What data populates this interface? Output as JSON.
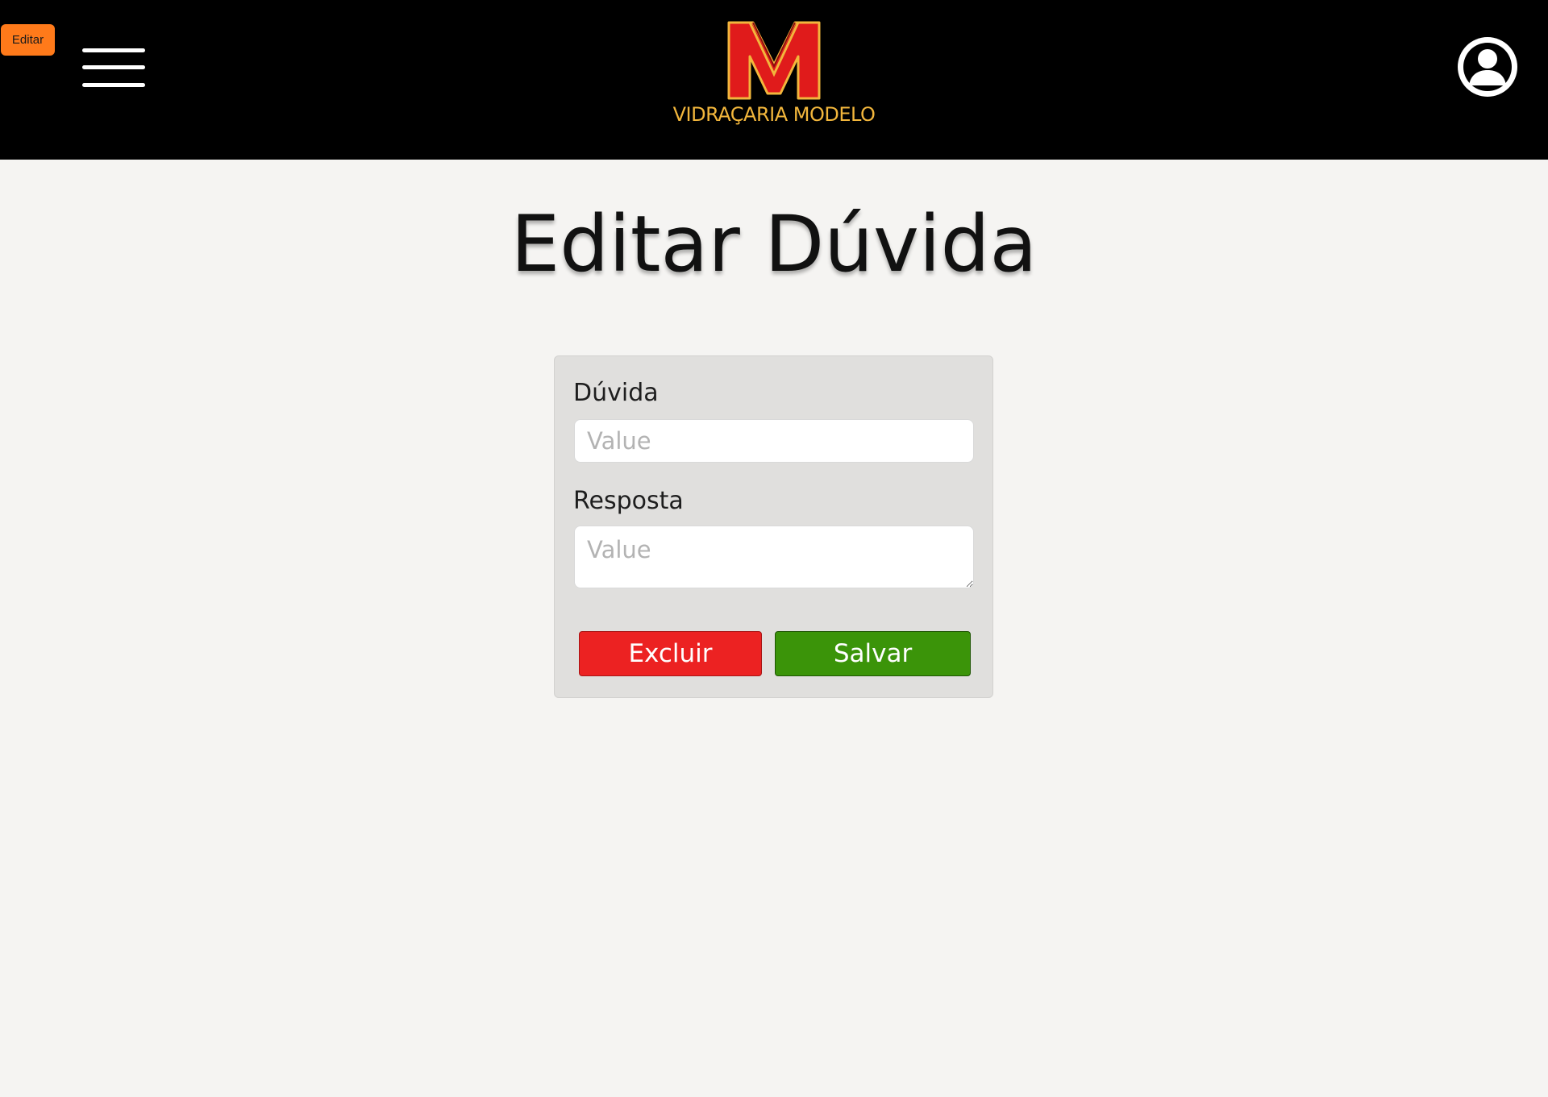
{
  "header": {
    "edit_badge": "Editar",
    "logo_text": "VIDRAÇARIA MODELO",
    "logo_icon": "logo-m-icon",
    "menu_icon": "hamburger-menu-icon",
    "profile_icon": "user-avatar-icon"
  },
  "page": {
    "title": "Editar Dúvida"
  },
  "form": {
    "question_label": "Dúvida",
    "question_placeholder": "Value",
    "answer_label": "Resposta",
    "answer_placeholder": "Value",
    "delete_label": "Excluir",
    "save_label": "Salvar"
  },
  "colors": {
    "header_bg": "#000000",
    "page_bg": "#f5f4f2",
    "card_bg": "#e0dfdd",
    "edit_badge": "#ff7a1a",
    "logo_red": "#e01b1b",
    "logo_gold": "#f2b63c",
    "delete_button": "#ec2222",
    "save_button": "#3b9409"
  }
}
